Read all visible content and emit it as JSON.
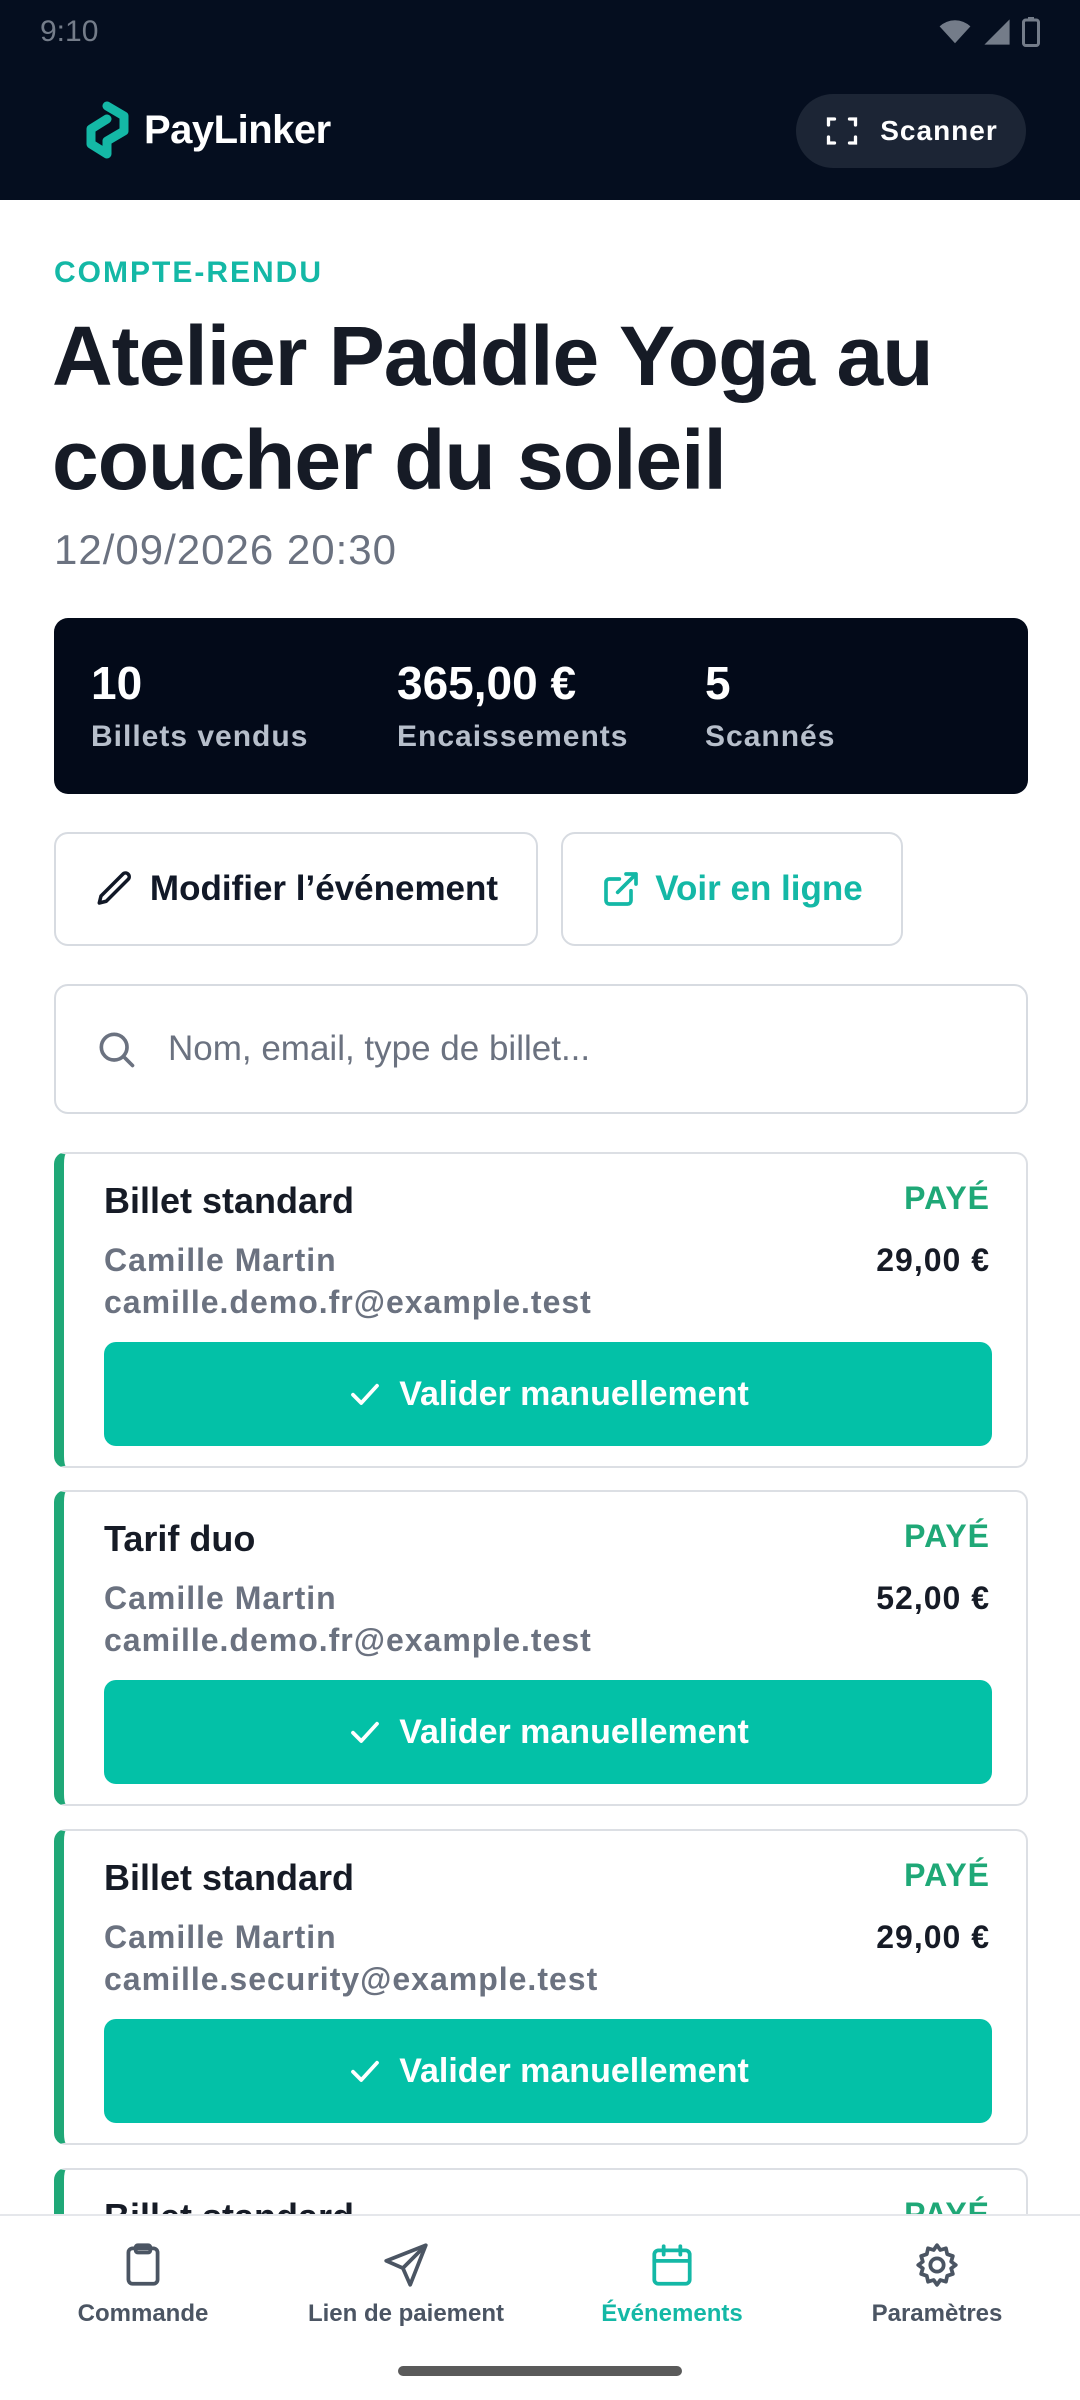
{
  "status_bar": {
    "time": "9:10"
  },
  "header": {
    "app_name": "PayLinker",
    "scan_label": "Scanner"
  },
  "page": {
    "eyebrow": "COMPTE-RENDU",
    "title": "Atelier Paddle Yoga au coucher du soleil",
    "datetime": "12/09/2026 20:30"
  },
  "stats": [
    {
      "value": "10",
      "label": "Billets vendus"
    },
    {
      "value": "365,00 €",
      "label": "Encaissements"
    },
    {
      "value": "5",
      "label": "Scannés"
    }
  ],
  "actions": {
    "edit_label": "Modifier l’événement",
    "online_label": "Voir en ligne"
  },
  "search": {
    "placeholder": "Nom, email, type de billet..."
  },
  "tickets": [
    {
      "type": "Billet standard",
      "status": "PAYÉ",
      "name": "Camille Martin",
      "price": "29,00 €",
      "email": "camille.demo.fr@example.test",
      "button": "Valider manuellement"
    },
    {
      "type": "Tarif duo",
      "status": "PAYÉ",
      "name": "Camille Martin",
      "price": "52,00 €",
      "email": "camille.demo.fr@example.test",
      "button": "Valider manuellement"
    },
    {
      "type": "Billet standard",
      "status": "PAYÉ",
      "name": "Camille Martin",
      "price": "29,00 €",
      "email": "camille.security@example.test",
      "button": "Valider manuellement"
    },
    {
      "type": "Billet standard",
      "status": "PAYÉ",
      "name": "",
      "price": "",
      "email": "",
      "button": ""
    }
  ],
  "nav": [
    {
      "label": "Commande",
      "icon": "clipboard-icon"
    },
    {
      "label": "Lien de paiement",
      "icon": "send-icon"
    },
    {
      "label": "Événements",
      "icon": "calendar-icon"
    },
    {
      "label": "Paramètres",
      "icon": "gear-icon"
    }
  ],
  "colors": {
    "accent": "#14b8a6",
    "paid": "#1fa877",
    "header_bg": "#050e1f",
    "button": "#03c1a7"
  }
}
